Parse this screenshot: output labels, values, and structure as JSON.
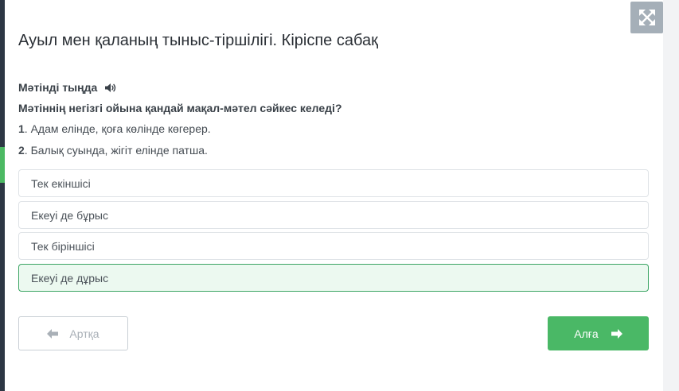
{
  "page": {
    "title": "Ауыл мен қаланың тыныс-тіршілігі. Кіріспе сабақ"
  },
  "task": {
    "listen_label": "Мәтінді тыңда",
    "question": "Мәтіннің негізгі ойына қандай мақал-мәтел сәйкес келеді?",
    "statements": [
      {
        "num": "1",
        "text": ". Адам елінде, қоға көлінде көгерер."
      },
      {
        "num": "2",
        "text": ". Балық суында, жігіт елінде патша."
      }
    ]
  },
  "options": [
    {
      "label": "Тек екіншісі",
      "selected": false
    },
    {
      "label": "Екеуі де бұрыс",
      "selected": false
    },
    {
      "label": "Тек біріншісі",
      "selected": false
    },
    {
      "label": "Екеуі де дұрыс",
      "selected": true
    }
  ],
  "nav": {
    "back_label": "Артқа",
    "next_label": "Алға"
  },
  "icons": {
    "fullscreen": "expand-arrows-icon",
    "speaker": "volume-icon",
    "back": "arrow-left-icon",
    "next": "arrow-right-icon"
  },
  "colors": {
    "accent_green": "#4ab866",
    "selected_bg": "#ecf9f0",
    "selected_border": "#3ca564",
    "sidebar_dark": "#2d3744"
  }
}
